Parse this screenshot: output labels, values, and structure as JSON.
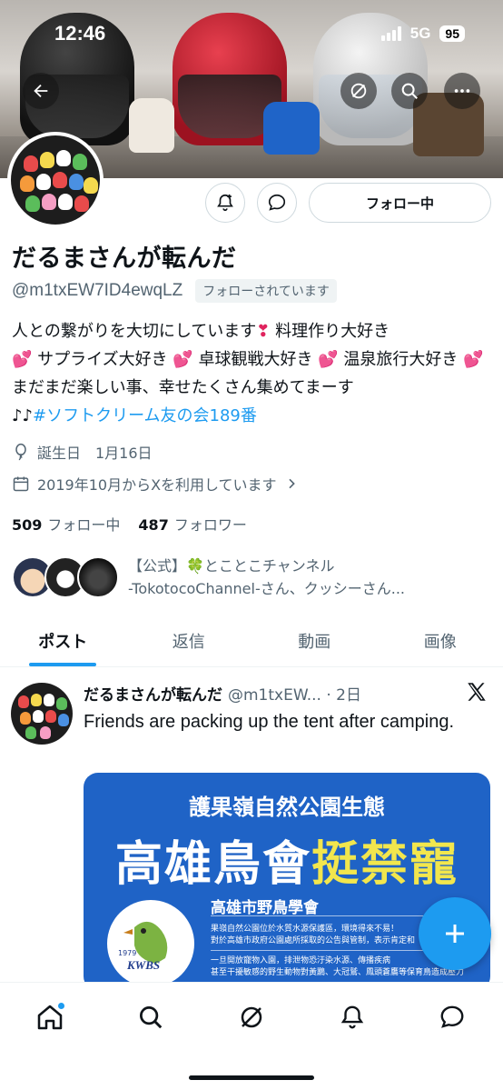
{
  "status_bar": {
    "time": "12:46",
    "network": "5G",
    "battery": "95"
  },
  "header": {
    "back_icon": "arrow-left-icon",
    "actions": [
      "grok-icon",
      "search-icon",
      "more-icon"
    ]
  },
  "profile": {
    "display_name": "だるまさんが転んだ",
    "handle": "@m1txEW7ID4ewqLZ",
    "follows_you": "フォローされています",
    "follow_button": "フォロー中",
    "bio": {
      "line1_a": "人との繋がりを大切にしています",
      "heart1": "❣",
      "line1_b": " 料理作り大好き",
      "sparkle": "💕",
      "seg2": " サプライズ大好き",
      "seg3": " 卓球観戦大好き",
      "seg4": " 温泉旅行大好き",
      "seg5": " まだまだ楽しい事、幸せたくさん集めてまーす",
      "notes": "♪♪",
      "hashtag": "#ソフトクリーム友の会189番"
    },
    "birthday": "誕生日　1月16日",
    "joined": "2019年10月からXを利用しています",
    "following_count": "509",
    "following_label": "フォロー中",
    "followers_count": "487",
    "followers_label": "フォロワー",
    "followed_by_line1": "【公式】🍀とことこチャンネル",
    "followed_by_line2": "-TokotocoChannel-さん、クッシーさん..."
  },
  "tabs": [
    {
      "label": "ポスト",
      "active": true
    },
    {
      "label": "返信",
      "active": false
    },
    {
      "label": "動画",
      "active": false
    },
    {
      "label": "画像",
      "active": false
    }
  ],
  "post": {
    "name": "だるまさんが転んだ",
    "handle_time": "@m1txEW... · 2日",
    "text": "Friends are packing up the tent after camping.",
    "media": {
      "title": "護果嶺自然公園生態",
      "headline_white": "高雄鳥會",
      "headline_yellow": "挺禁寵",
      "org": "高雄市野鳥學會",
      "body1": "果嶺自然公園位於水質水源保護區，環境得來不易！",
      "body2": "對於高雄市政府公園處所採取的公告與管制，表示肯定和",
      "body3": "一旦開放寵物入園，排泄物恐汙染水源、傳播疾病",
      "body4": "甚至干擾敏感的野生動物對黃鸝、大冠鷲、鳳頭蒼鷹等保育鳥造成壓力",
      "logo_text": "KWBS",
      "logo_year": "1979"
    }
  },
  "bottom_nav": [
    "home-icon",
    "search-icon",
    "grok-icon",
    "notifications-icon",
    "messages-icon"
  ],
  "colors": {
    "accent": "#1d9bf0",
    "text": "#0f1419",
    "secondary": "#536471"
  }
}
